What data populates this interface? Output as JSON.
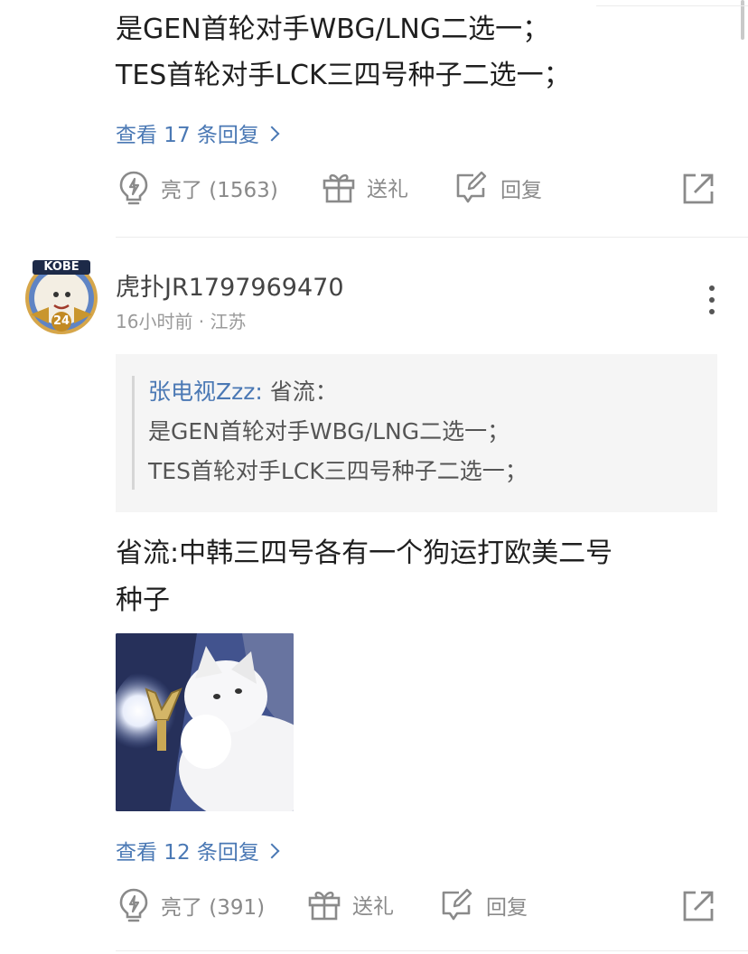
{
  "top_comment": {
    "text_line1": "是GEN首轮对手WBG/LNG二选一；",
    "text_line2": "TES首轮对手LCK三四号种子二选一；",
    "view_replies": "查看 17 条回复",
    "actions": {
      "like_label": "亮了 (1563)",
      "gift_label": "送礼",
      "reply_label": "回复"
    }
  },
  "comment": {
    "avatar_badge": "KOBE",
    "avatar_number": "24",
    "username": "虎扑JR1797969470",
    "meta": "16小时前 · 江苏",
    "quote": {
      "author": "张电视Zzz:",
      "line1_rest": " 省流：",
      "line2": "是GEN首轮对手WBG/LNG二选一；",
      "line3": "TES首轮对手LCK三四号种子二选一；"
    },
    "body_line1": "省流:中韩三四号各有一个狗运打欧美二号",
    "body_line2": "种子",
    "view_replies": "查看 12 条回复",
    "actions": {
      "like_label": "亮了 (391)",
      "gift_label": "送礼",
      "reply_label": "回复"
    }
  },
  "icons": [
    "lightbulb-icon",
    "gift-icon",
    "reply-edit-icon",
    "share-icon",
    "more-vertical-icon",
    "chevron-right-icon"
  ],
  "colors": {
    "link": "#4a78b4",
    "muted": "#8a8a8a",
    "text": "#1f1f1f",
    "quote_bg": "#f5f5f5"
  }
}
